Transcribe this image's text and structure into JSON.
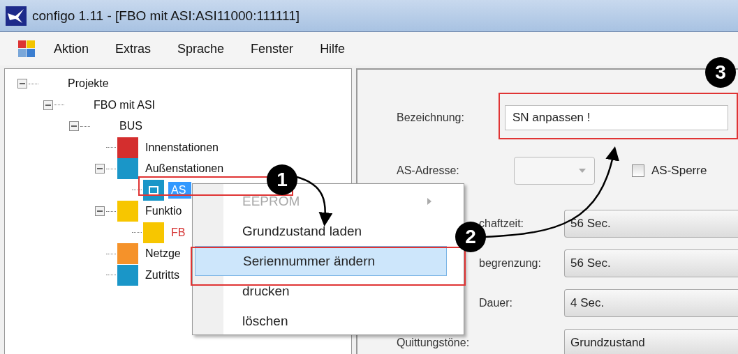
{
  "window": {
    "title": "configo 1.11 - [FBO mit ASI:ASI11000:111111]"
  },
  "menu_bar": [
    "Aktion",
    "Extras",
    "Sprache",
    "Fenster",
    "Hilfe"
  ],
  "tree": [
    {
      "label": "Projekte",
      "expanded": true,
      "children": [
        {
          "label": "FBO mit ASI",
          "expanded": true,
          "children": [
            {
              "label": "BUS",
              "expanded": true,
              "children": [
                {
                  "label": "Innenstationen",
                  "color": "#d42e2e"
                },
                {
                  "label": "Außenstationen",
                  "color": "#1a96c8",
                  "expanded": true,
                  "children": [
                    {
                      "label": "AS",
                      "color": "#1a96c8",
                      "selected": true
                    }
                  ]
                },
                {
                  "label": "Funktio",
                  "color": "#f7c600",
                  "expanded": true,
                  "children": [
                    {
                      "label": "FB",
                      "color": "#f7c600",
                      "selected": false,
                      "kind": "alert"
                    }
                  ]
                },
                {
                  "label": "Netzge",
                  "color": "#f5922a"
                },
                {
                  "label": "Zutritts",
                  "color": "#1a96c8"
                }
              ]
            }
          ]
        }
      ]
    }
  ],
  "context_menu": [
    {
      "label": "EEPROM",
      "disabled": true,
      "submenu": true,
      "selected": false
    },
    {
      "label": "Grundzustand laden",
      "disabled": false,
      "submenu": false,
      "selected": false
    },
    {
      "label": "Seriennummer ändern",
      "disabled": false,
      "submenu": false,
      "selected": true
    },
    {
      "label": "drucken",
      "disabled": false,
      "submenu": false,
      "selected": false
    },
    {
      "label": "löschen",
      "disabled": false,
      "submenu": false,
      "selected": false
    }
  ],
  "form": {
    "name": {
      "label": "Bezeichnung:",
      "value": "SN anpassen !"
    },
    "address": {
      "label": "AS-Adresse:",
      "disabled": true
    },
    "lock": {
      "label": "AS-Sperre",
      "checked": false
    },
    "settings": [
      {
        "label": "chaftzeit:",
        "value": "56 Sec."
      },
      {
        "label": "begrenzung:",
        "value": "56 Sec."
      },
      {
        "label": "Dauer:",
        "value": "4 Sec."
      },
      {
        "label": "Quittungstöne:",
        "value": "Grundzustand"
      }
    ]
  },
  "callouts": [
    "1",
    "2",
    "3"
  ]
}
